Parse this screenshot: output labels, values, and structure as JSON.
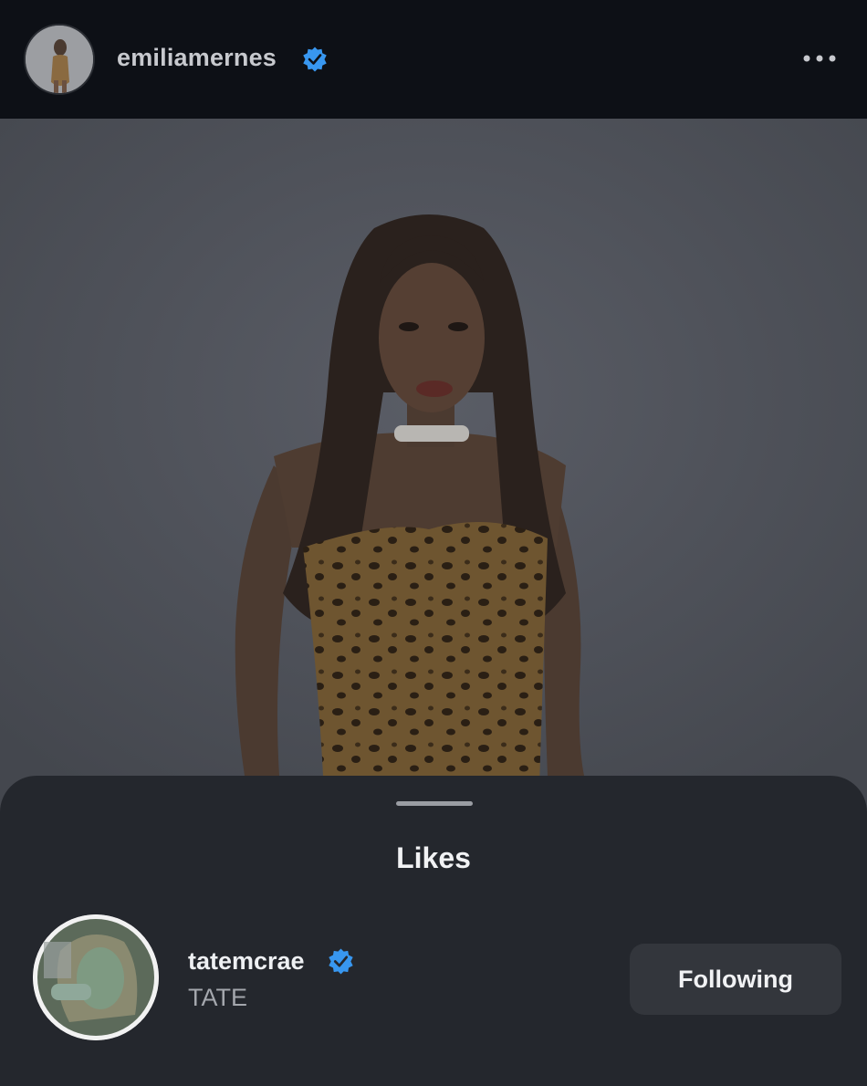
{
  "post": {
    "author_username": "emiliamernes",
    "author_verified": true,
    "menu_icon": "more-horizontal-icon",
    "verified_color": "#3897f0"
  },
  "likes_sheet": {
    "title": "Likes",
    "items": [
      {
        "username": "tatemcrae",
        "verified": true,
        "full_name": "TATE",
        "follow_button_label": "Following"
      }
    ]
  }
}
